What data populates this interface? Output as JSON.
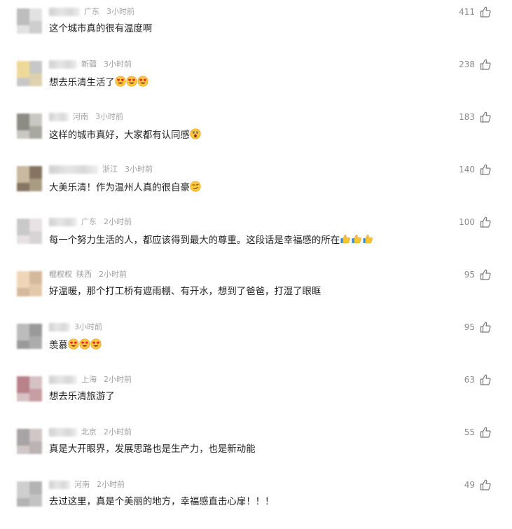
{
  "comments": [
    {
      "location": "广东",
      "time": "3小时前",
      "text": "这个城市真的很有温度啊",
      "likes": "411",
      "emojis": [],
      "avatar_colors": [
        "#bdbdbd",
        "#e2e2e2"
      ],
      "nick_width": 44
    },
    {
      "location": "新疆",
      "time": "3小时前",
      "text": "想去乐清生活了",
      "likes": "238",
      "emojis": [
        "heart-eyes",
        "heart-eyes",
        "heart-eyes"
      ],
      "avatar_colors": [
        "#efd999",
        "#c7c7c7"
      ],
      "nick_width": 40
    },
    {
      "location": "河南",
      "time": "3小时前",
      "text": "这样的城市真好，大家都有认同感",
      "likes": "183",
      "emojis": [
        "astonished"
      ],
      "avatar_colors": [
        "#8c8c84",
        "#c9c8c2"
      ],
      "nick_width": 28
    },
    {
      "location": "浙江",
      "time": "3小时前",
      "text": "大美乐清！作为温州人真的很自豪",
      "likes": "140",
      "emojis": [
        "smirk"
      ],
      "avatar_colors": [
        "#c8b99f",
        "#857562"
      ],
      "nick_width": 70
    },
    {
      "location": "广东",
      "time": "2小时前",
      "text": "每一个努力生活的人，都应该得到最大的尊重。这段话是幸福感的所在",
      "likes": "100",
      "emojis": [
        "thumbs-up",
        "thumbs-up",
        "thumbs-up"
      ],
      "avatar_colors": [
        "#c9c9c9",
        "#e8e2e4"
      ],
      "nick_width": 40
    },
    {
      "location": "陕西",
      "time": "2小时前",
      "nick_text": "棍权权",
      "text": "好温暖，那个打工桥有遮雨棚、有开水，想到了爸爸，打湿了眼眶",
      "likes": "95",
      "emojis": [],
      "avatar_colors": [
        "#f0d6b8",
        "#d5b99c"
      ],
      "nick_width": 0
    },
    {
      "location": "",
      "time": "3小时前",
      "text": "羡慕",
      "likes": "95",
      "emojis": [
        "heart-eyes",
        "heart-eyes",
        "heart-eyes"
      ],
      "avatar_colors": [
        "#bcbcbc",
        "#9a9a9a"
      ],
      "nick_width": 30
    },
    {
      "location": "上海",
      "time": "2小时前",
      "text": "想去乐清旅游了",
      "likes": "63",
      "emojis": [],
      "avatar_colors": [
        "#b9818a",
        "#d6c2c4"
      ],
      "nick_width": 40
    },
    {
      "location": "北京",
      "time": "2小时前",
      "text": "真是大开眼界，发展思路也是生产力，也是新动能",
      "likes": "55",
      "emojis": [],
      "avatar_colors": [
        "#a8a3a4",
        "#d0c6c6"
      ],
      "nick_width": 40
    },
    {
      "location": "河南",
      "time": "2小时前",
      "text": "去过这里，真是个美丽的地方，幸福感直击心扉！！！",
      "likes": "49",
      "emojis": [],
      "avatar_colors": [
        "#cfcfcf",
        "#b3b3b3"
      ],
      "nick_width": 30
    }
  ]
}
